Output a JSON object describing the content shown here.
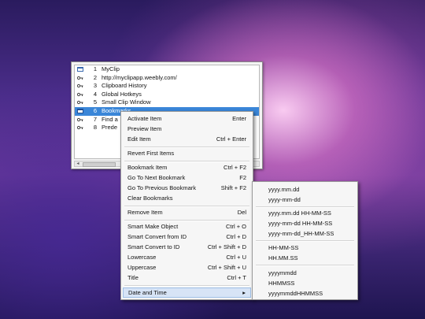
{
  "clip_list": {
    "items": [
      {
        "num": "1",
        "text": "MyClip",
        "icon": "clip-window-icon"
      },
      {
        "num": "2",
        "text": "http://myclipapp.weebly.com/",
        "icon": "key-icon"
      },
      {
        "num": "3",
        "text": "Clipboard History",
        "icon": "key-icon"
      },
      {
        "num": "4",
        "text": "Global Hotkeys",
        "icon": "key-icon"
      },
      {
        "num": "5",
        "text": "Small Clip Window",
        "icon": "key-icon"
      },
      {
        "num": "6",
        "text": "Bookmarks",
        "icon": "clip-window-icon",
        "selected": true
      },
      {
        "num": "7",
        "text": "Find a",
        "icon": "key-icon"
      },
      {
        "num": "8",
        "text": "Prede",
        "icon": "key-icon"
      }
    ]
  },
  "context_menu": {
    "activate": {
      "label": "Activate Item",
      "key": "Enter"
    },
    "preview": {
      "label": "Preview Item",
      "key": ""
    },
    "edit": {
      "label": "Edit Item",
      "key": "Ctrl + Enter"
    },
    "revert": {
      "label": "Revert First Items",
      "key": ""
    },
    "bookmark": {
      "label": "Bookmark Item",
      "key": "Ctrl + F2"
    },
    "next_bookmark": {
      "label": "Go To Next Bookmark",
      "key": "F2"
    },
    "prev_bookmark": {
      "label": "Go To Previous Bookmark",
      "key": "Shift + F2"
    },
    "clear_bookmarks": {
      "label": "Clear Bookmarks",
      "key": ""
    },
    "remove": {
      "label": "Remove Item",
      "key": "Del"
    },
    "smart_make": {
      "label": "Smart Make Object",
      "key": "Ctrl + O"
    },
    "smart_from_id": {
      "label": "Smart Convert from ID",
      "key": "Ctrl + D"
    },
    "smart_to_id": {
      "label": "Smart Convert to ID",
      "key": "Ctrl + Shift + D"
    },
    "lowercase": {
      "label": "Lowercase",
      "key": "Ctrl + U"
    },
    "uppercase": {
      "label": "Uppercase",
      "key": "Ctrl + Shift + U"
    },
    "title": {
      "label": "Title",
      "key": "Ctrl + T"
    },
    "date_time": {
      "label": "Date and Time",
      "key": "▸"
    }
  },
  "date_submenu": {
    "f1": "yyyy.mm.dd",
    "f2": "yyyy-mm-dd",
    "f3": "yyyy.mm.dd HH-MM-SS",
    "f4": "yyyy-mm-dd HH-MM-SS",
    "f5": "yyyy-mm-dd_HH-MM-SS",
    "f6": "HH-MM-SS",
    "f7": "HH.MM.SS",
    "f8": "yyyymmdd",
    "f9": "HHMMSS",
    "f10": "yyyymmddHHMMSS"
  }
}
